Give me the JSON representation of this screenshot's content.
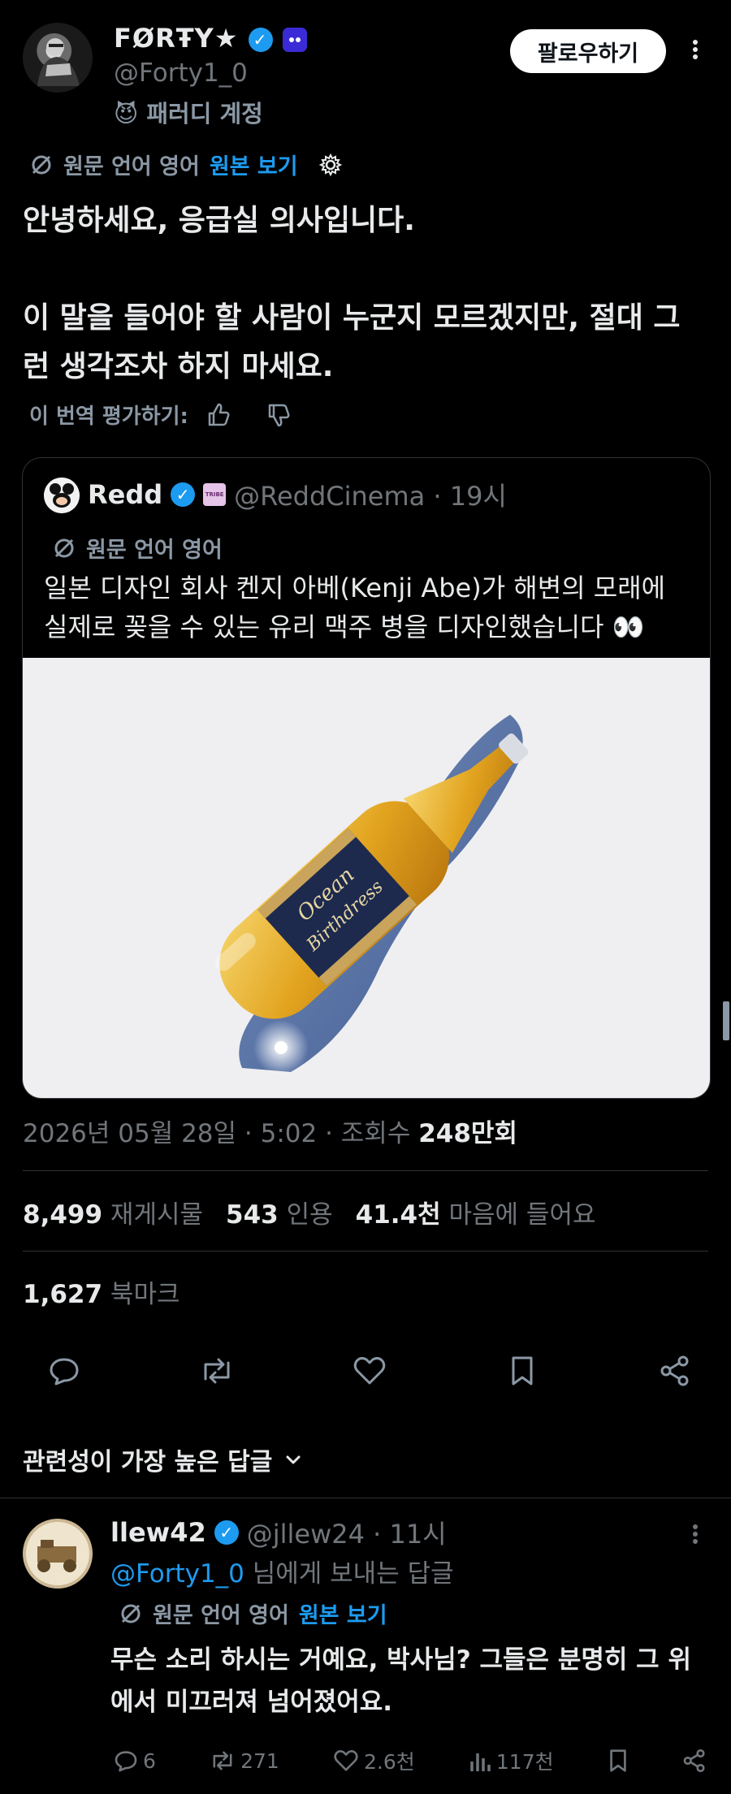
{
  "post": {
    "display_name": "FØRŦY★",
    "handle": "@Forty1_0",
    "account_label": "패러디 계정",
    "follow_label": "팔로우하기",
    "translation_note": "원문 언어 영어",
    "view_original": "원본 보기",
    "text": "안녕하세요, 응급실 의사입니다.\n\n이 말을 들어야 할 사람이 누군지 모르겠지만, 절대 그런 생각조차 하지 마세요.",
    "rate_translation": "이 번역 평가하기:",
    "date": "2026년 05월 28일 · 5:02 · 조회수",
    "views": "248만회",
    "reposts_count": "8,499",
    "reposts_label": "재게시물",
    "quotes_count": "543",
    "quotes_label": "인용",
    "likes_count": "41.4천",
    "likes_label": "마음에 들어요",
    "bookmarks_count": "1,627",
    "bookmarks_label": "북마크"
  },
  "quote": {
    "name": "Redd",
    "handle_time": "@ReddCinema · 19시",
    "translation_note": "원문 언어 영어",
    "text": "일본 디자인 회사 켄지 아베(Kenji Abe)가 해변의 모래에 실제로 꽂을 수 있는 유리 맥주 병을 디자인했습니다 👀",
    "badge": "TRIBE",
    "bottle_label_line1": "Ocean",
    "bottle_label_line2": "Birthdress"
  },
  "sort": {
    "label": "관련성이 가장 높은 답글"
  },
  "reply": {
    "name": "llew42",
    "handle_time": "@jllew24 · 11시",
    "replying_to": "@Forty1_0",
    "replying_suffix": " 님에게 보내는 답글",
    "translation_note": "원문 언어 영어",
    "view_original": "원본 보기",
    "text": "무슨 소리 하시는 거예요, 박사님? 그들은 분명히 그 위에서 미끄러져 넘어졌어요.",
    "replies": "6",
    "reposts": "271",
    "likes": "2.6천",
    "views": "117천"
  },
  "icons": [
    "verified-icon",
    "parody-mask-icon",
    "translate-icon",
    "settings-gear-icon",
    "thumbs-up-icon",
    "thumbs-down-icon",
    "reply-icon",
    "repost-icon",
    "like-icon",
    "bookmark-icon",
    "share-icon",
    "chevron-down-icon",
    "views-icon",
    "more-icon"
  ],
  "colors": {
    "background": "#000000",
    "text": "#e7e9ea",
    "muted": "#71767b",
    "accent": "#1d9bf0",
    "divider": "#2f3336"
  }
}
